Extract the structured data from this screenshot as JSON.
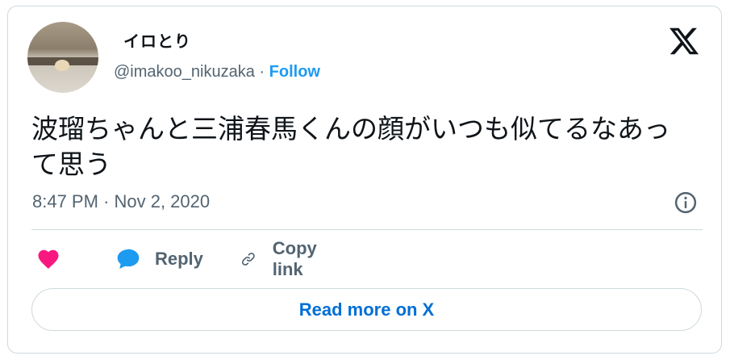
{
  "user": {
    "display_name": "イロとり",
    "handle": "@imakoo_nikuzaka",
    "separator": "·",
    "follow_label": "Follow"
  },
  "tweet": {
    "text": "波瑠ちゃんと三浦春馬くんの顔がいつも似てるなあって思う",
    "timestamp": "8:47 PM · Nov 2, 2020"
  },
  "actions": {
    "like_label": "",
    "reply_label": "Reply",
    "copy_link_label": "Copy link"
  },
  "read_more_label": "Read more on X",
  "icons": [
    "x-logo-icon",
    "info-icon",
    "heart-icon",
    "reply-bubble-icon",
    "link-icon"
  ],
  "colors": {
    "like": "#f91880",
    "reply": "#1d9bf0",
    "follow": "#1d9bf0",
    "read_more": "#006fd6",
    "secondary_text": "#536471",
    "border": "#cfd9de"
  }
}
